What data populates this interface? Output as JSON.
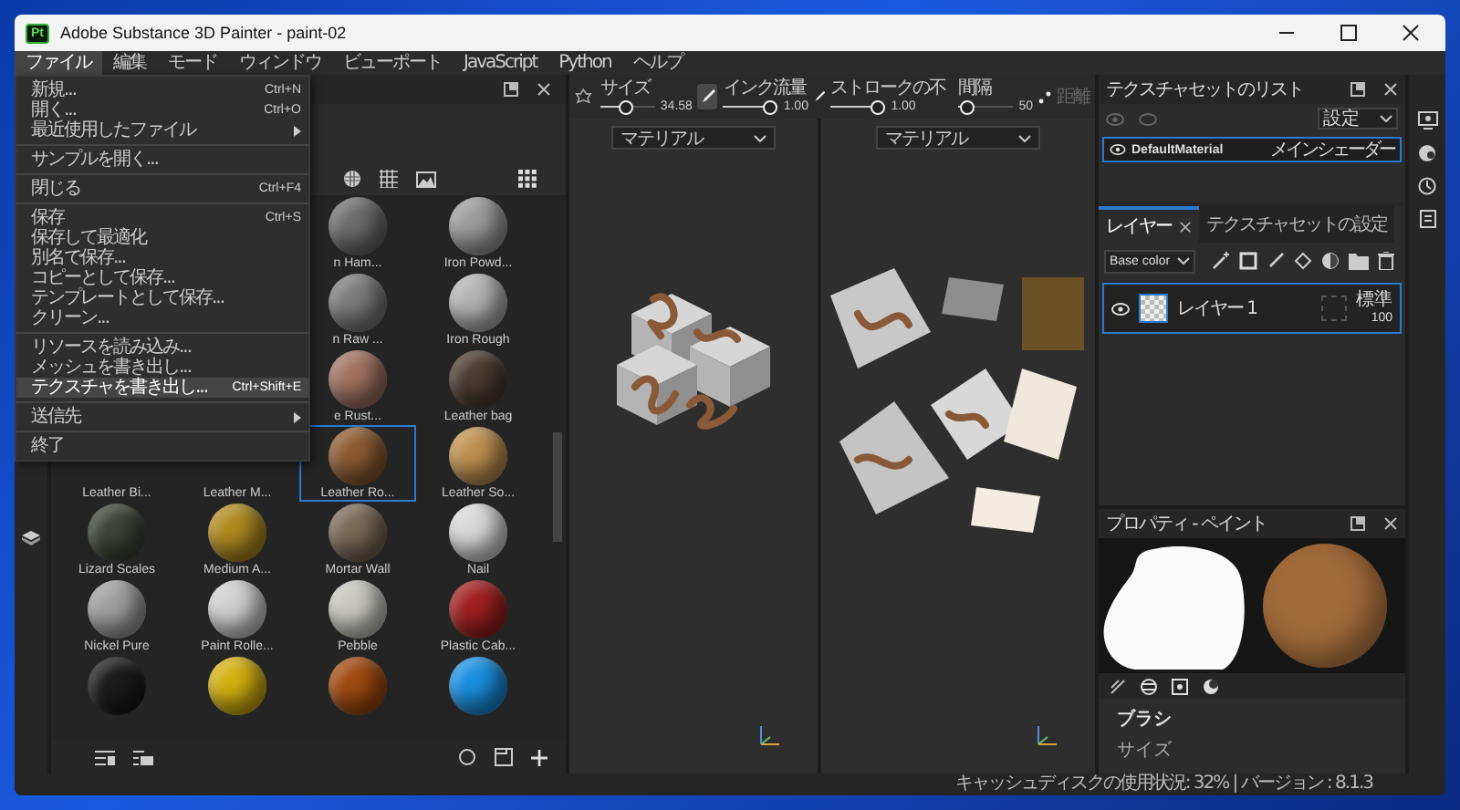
{
  "window": {
    "app_icon": "Pt",
    "title": "Adobe Substance 3D Painter - paint-02"
  },
  "menu_bar": [
    {
      "label": "ファイル",
      "selected": true
    },
    {
      "label": "編集",
      "selected": false
    },
    {
      "label": "モード",
      "selected": false
    },
    {
      "label": "ウィンドウ",
      "selected": false
    },
    {
      "label": "ビューポート",
      "selected": false
    },
    {
      "label": "JavaScript",
      "selected": false
    },
    {
      "label": "Python",
      "selected": false
    },
    {
      "label": "ヘルプ",
      "selected": false
    }
  ],
  "file_menu": [
    {
      "kind": "item",
      "label": "新規...",
      "shortcut": "Ctrl+N",
      "selected": false
    },
    {
      "kind": "item",
      "label": "開く...",
      "shortcut": "Ctrl+O",
      "selected": false
    },
    {
      "kind": "item",
      "label": "最近使用したファイル",
      "has_submenu": true,
      "selected": false
    },
    {
      "kind": "separator"
    },
    {
      "kind": "item",
      "label": "サンプルを開く...",
      "selected": false
    },
    {
      "kind": "separator"
    },
    {
      "kind": "item",
      "label": "閉じる",
      "shortcut": "Ctrl+F4",
      "selected": false
    },
    {
      "kind": "separator"
    },
    {
      "kind": "item",
      "label": "保存",
      "shortcut": "Ctrl+S",
      "selected": false
    },
    {
      "kind": "item",
      "label": "保存して最適化",
      "selected": false
    },
    {
      "kind": "item",
      "label": "別名で保存...",
      "selected": false
    },
    {
      "kind": "item",
      "label": "コピーとして保存...",
      "selected": false
    },
    {
      "kind": "item",
      "label": "テンプレートとして保存...",
      "selected": false
    },
    {
      "kind": "item",
      "label": "クリーン...",
      "selected": false
    },
    {
      "kind": "separator"
    },
    {
      "kind": "item",
      "label": "リソースを読み込み...",
      "selected": false
    },
    {
      "kind": "item",
      "label": "メッシュを書き出し...",
      "selected": false
    },
    {
      "kind": "item",
      "label": "テクスチャを書き出し...",
      "shortcut": "Ctrl+Shift+E",
      "selected": true
    },
    {
      "kind": "separator"
    },
    {
      "kind": "item",
      "label": "送信先",
      "has_submenu": true,
      "selected": false
    },
    {
      "kind": "separator"
    },
    {
      "kind": "item",
      "label": "終了",
      "selected": false
    }
  ],
  "shelf": {
    "partly_covered_materials": [
      {
        "name": "n Ham...",
        "color": "#6e6e6e",
        "selected": false
      },
      {
        "name": "Iron Powd...",
        "color": "#9c9c9c",
        "selected": false
      },
      {
        "name": "n Raw ...",
        "color": "#7c7c7c",
        "selected": false
      },
      {
        "name": "Iron Rough",
        "color": "#b4b4b4",
        "selected": false
      },
      {
        "name": "e Rust...",
        "color": "#a07262",
        "selected": false
      },
      {
        "name": "Leather bag",
        "color": "#4c3c32",
        "selected": false
      }
    ],
    "materials": [
      {
        "name": "Leather Bi...",
        "selected": false
      },
      {
        "name": "Leather M...",
        "selected": false
      },
      {
        "name": "Leather Ro...",
        "color": "#8c5c32",
        "selected": true
      },
      {
        "name": "Leather So...",
        "color": "#c09050",
        "selected": false
      },
      {
        "name": "Lizard Scales",
        "color": "#3e4438",
        "selected": false
      },
      {
        "name": "Medium A...",
        "color": "#b08a20",
        "selected": false
      },
      {
        "name": "Mortar Wall",
        "color": "#7a6a58",
        "selected": false
      },
      {
        "name": "Nail",
        "color": "#d8d8d8",
        "selected": false
      },
      {
        "name": "Nickel Pure",
        "color": "#a0a0a0",
        "selected": false
      },
      {
        "name": "Paint Rolle...",
        "color": "#d0d0d0",
        "selected": false
      },
      {
        "name": "Pebble",
        "color": "#c8c8c0",
        "selected": false
      },
      {
        "name": "Plastic Cab...",
        "color": "#a02020",
        "selected": false
      },
      {
        "color": "#1c1c1c",
        "selected": false
      },
      {
        "color": "#d4b010",
        "selected": false
      },
      {
        "color": "#a04a10",
        "selected": false
      },
      {
        "color": "#1a90e0",
        "selected": false
      }
    ]
  },
  "toolbar": {
    "sliders": [
      {
        "label": "サイズ",
        "value": "34.58",
        "level": 0.45
      },
      {
        "label": "インク流量",
        "value": "1.00",
        "level": 1
      },
      {
        "label": "ストロークの不",
        "value": "1.00",
        "level": 1
      },
      {
        "label": "間隔",
        "value": "50",
        "level": 0.05
      }
    ],
    "distance_label": "距離"
  },
  "viewports": [
    {
      "dropdown": "マテリアル",
      "kind": "model"
    },
    {
      "dropdown": "マテリアル",
      "kind": "uv"
    }
  ],
  "texture_set_list": {
    "title": "テクスチャセットのリスト",
    "settings": "設定",
    "items": [
      {
        "name": "DefaultMaterial",
        "shader": "メインシェーダー",
        "selected": true
      }
    ]
  },
  "layer_tabs": [
    {
      "label": "レイヤー",
      "selected": true
    },
    {
      "label": "テクスチャセットの設定",
      "selected": false
    }
  ],
  "channel": "Base color",
  "layers": [
    {
      "name": "レイヤー 1",
      "blend": "標準",
      "opacity": "100",
      "selected": true
    }
  ],
  "properties": {
    "title": "プロパティ - ペイント",
    "section": "ブラシ",
    "field": "サイズ"
  },
  "status_bar": "キャッシュディスクの使用状況: 32% | バージョン : 8.1.3"
}
